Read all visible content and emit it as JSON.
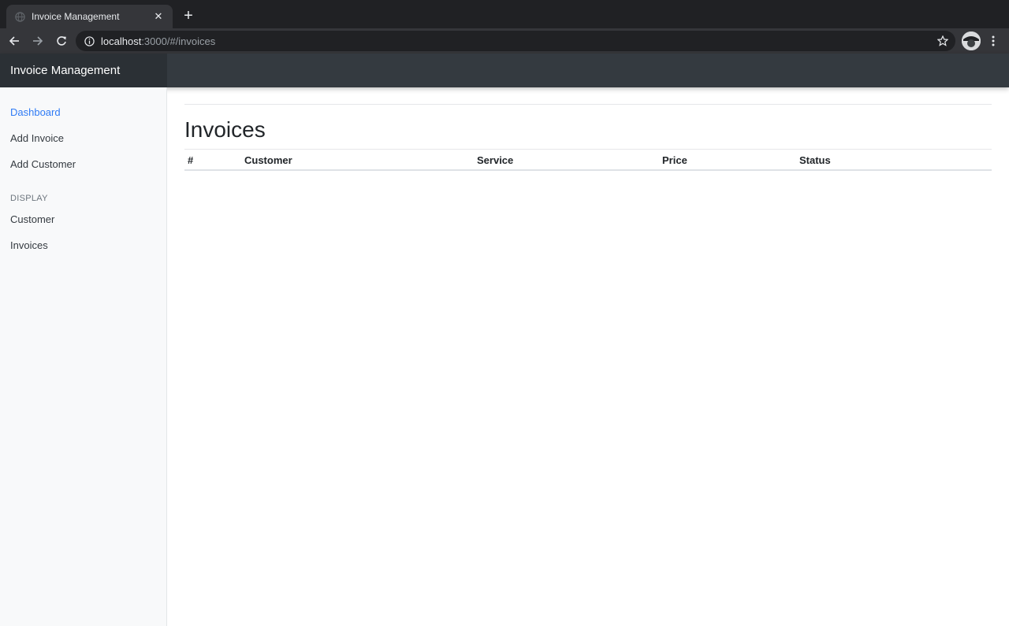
{
  "browser": {
    "tab_title": "Invoice Management",
    "tab_close": "✕",
    "new_tab": "+",
    "url_host": "localhost",
    "url_rest": ":3000/#/invoices"
  },
  "app": {
    "brand": "Invoice Management"
  },
  "sidebar": {
    "links_top": [
      {
        "label": "Dashboard",
        "active": true
      },
      {
        "label": "Add Invoice",
        "active": false
      },
      {
        "label": "Add Customer",
        "active": false
      }
    ],
    "section_heading": "DISPLAY",
    "links_display": [
      {
        "label": "Customer",
        "active": false
      },
      {
        "label": "Invoices",
        "active": false
      }
    ]
  },
  "main": {
    "title": "Invoices",
    "table": {
      "columns": [
        "#",
        "Customer",
        "Service",
        "Price",
        "Status"
      ],
      "rows": []
    }
  },
  "colors": {
    "active_link": "#2f7bf5",
    "navbar": "#343a40",
    "brand_bg": "#2b3035"
  }
}
